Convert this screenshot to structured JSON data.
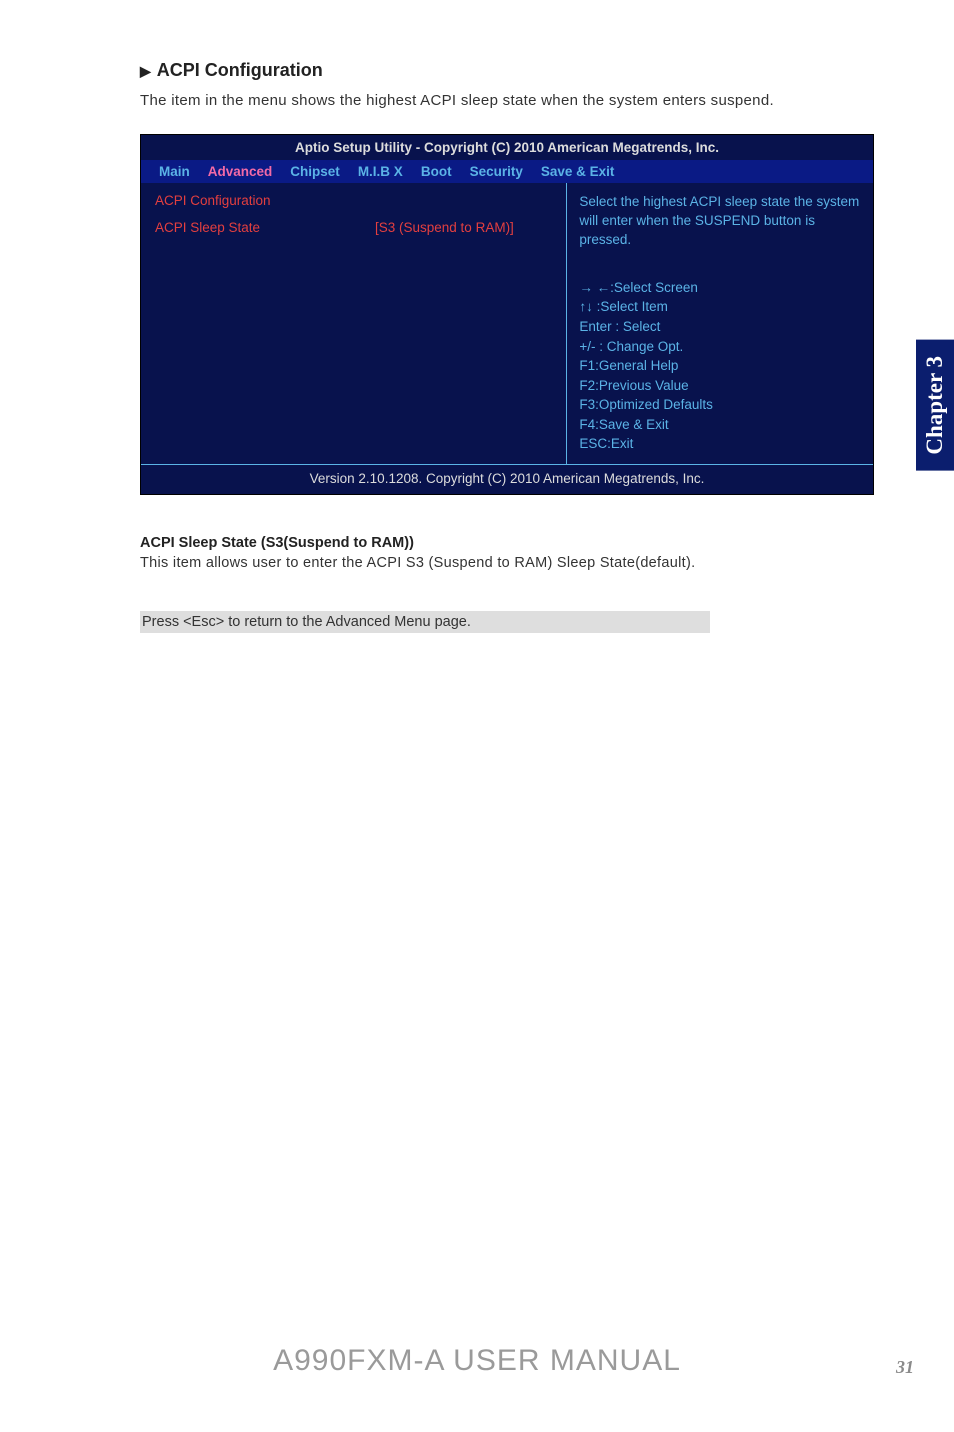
{
  "heading": {
    "marker": "▶",
    "text": "ACPI Configuration"
  },
  "intro": "The item in the menu shows the highest ACPI sleep state when the system enters suspend.",
  "bios": {
    "title": "Aptio Setup Utility - Copyright (C) 2010 American Megatrends, Inc.",
    "tabs": {
      "main": "Main",
      "advanced": "Advanced",
      "chipset": "Chipset",
      "mibx": "M.I.B X",
      "boot": "Boot",
      "security": "Security",
      "save": "Save & Exit"
    },
    "left": {
      "config_label": "ACPI Configuration",
      "row1_label": "ACPI Sleep State",
      "row1_value": "[S3 (Suspend to RAM)]"
    },
    "right": {
      "help": "Select the highest ACPI sleep state the system will enter when the SUSPEND button is pressed.",
      "nav1": "→ ←:Select Screen",
      "nav2": "↑↓ :Select Item",
      "nav3": "Enter : Select",
      "nav4": "+/-  : Change Opt.",
      "nav5": "F1:General Help",
      "nav6": "F2:Previous Value",
      "nav7": "F3:Optimized Defaults",
      "nav8": "F4:Save & Exit",
      "nav9": "ESC:Exit"
    },
    "footer": "Version 2.10.1208. Copyright (C) 2010  American Megatrends, Inc."
  },
  "sub": {
    "heading": "ACPI Sleep State (S3(Suspend to RAM))",
    "text": "This item allows user to enter the ACPI S3 (Suspend to RAM) Sleep State(default)."
  },
  "esc_note": "Press <Esc> to return to the Advanced Menu page.",
  "side_tab": "Chapter 3",
  "bottom_title": "A990FXM-A USER MANUAL",
  "page_num": "31"
}
